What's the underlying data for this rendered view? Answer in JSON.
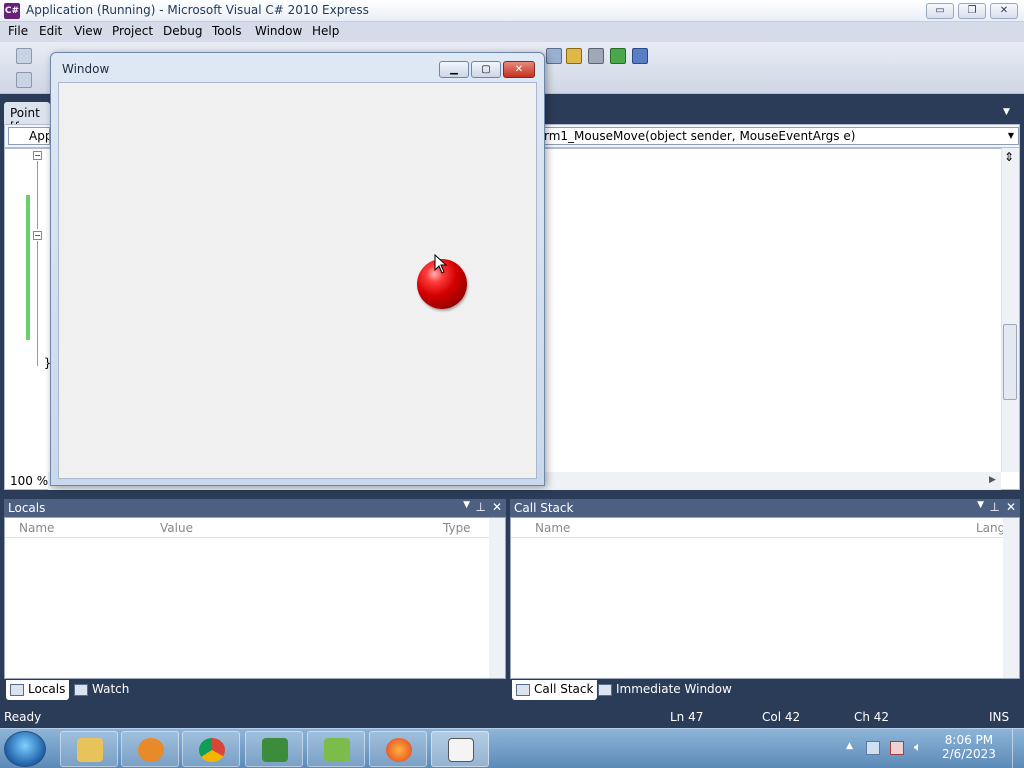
{
  "window": {
    "title": "Application (Running) - Microsoft Visual C# 2010 Express",
    "app_icon": "C#",
    "controls": {
      "minimize": "▭",
      "restore": "❐",
      "close": "✕"
    }
  },
  "menu": [
    "File",
    "Edit",
    "View",
    "Project",
    "Debug",
    "Tools",
    "Window",
    "Help"
  ],
  "document": {
    "tab_label": "Point [f",
    "nav_left": "Appl",
    "nav_right": "rm1_MouseMove(object sender, MouseEventArgs e)",
    "zoom": "100 %",
    "closing_brace": "}"
  },
  "running_app": {
    "title": "Window",
    "ball_color": "#d30000"
  },
  "locals_panel": {
    "title": "Locals",
    "columns": [
      "Name",
      "Value",
      "Type"
    ]
  },
  "callstack_panel": {
    "title": "Call Stack",
    "columns": [
      "Name",
      "Lang"
    ]
  },
  "left_tabs": [
    "Locals",
    "Watch"
  ],
  "right_tabs": [
    "Call Stack",
    "Immediate Window"
  ],
  "status": {
    "state": "Ready",
    "line": "Ln 47",
    "col": "Col 42",
    "ch": "Ch 42",
    "mode": "INS"
  },
  "taskbar": {
    "apps": [
      "explorer-icon",
      "media-player-icon",
      "chrome-icon",
      "visual-csharp-icon",
      "editor-icon",
      "firefox-icon",
      "running-app-icon"
    ],
    "time": "8:06 PM",
    "date": "2/6/2023"
  }
}
